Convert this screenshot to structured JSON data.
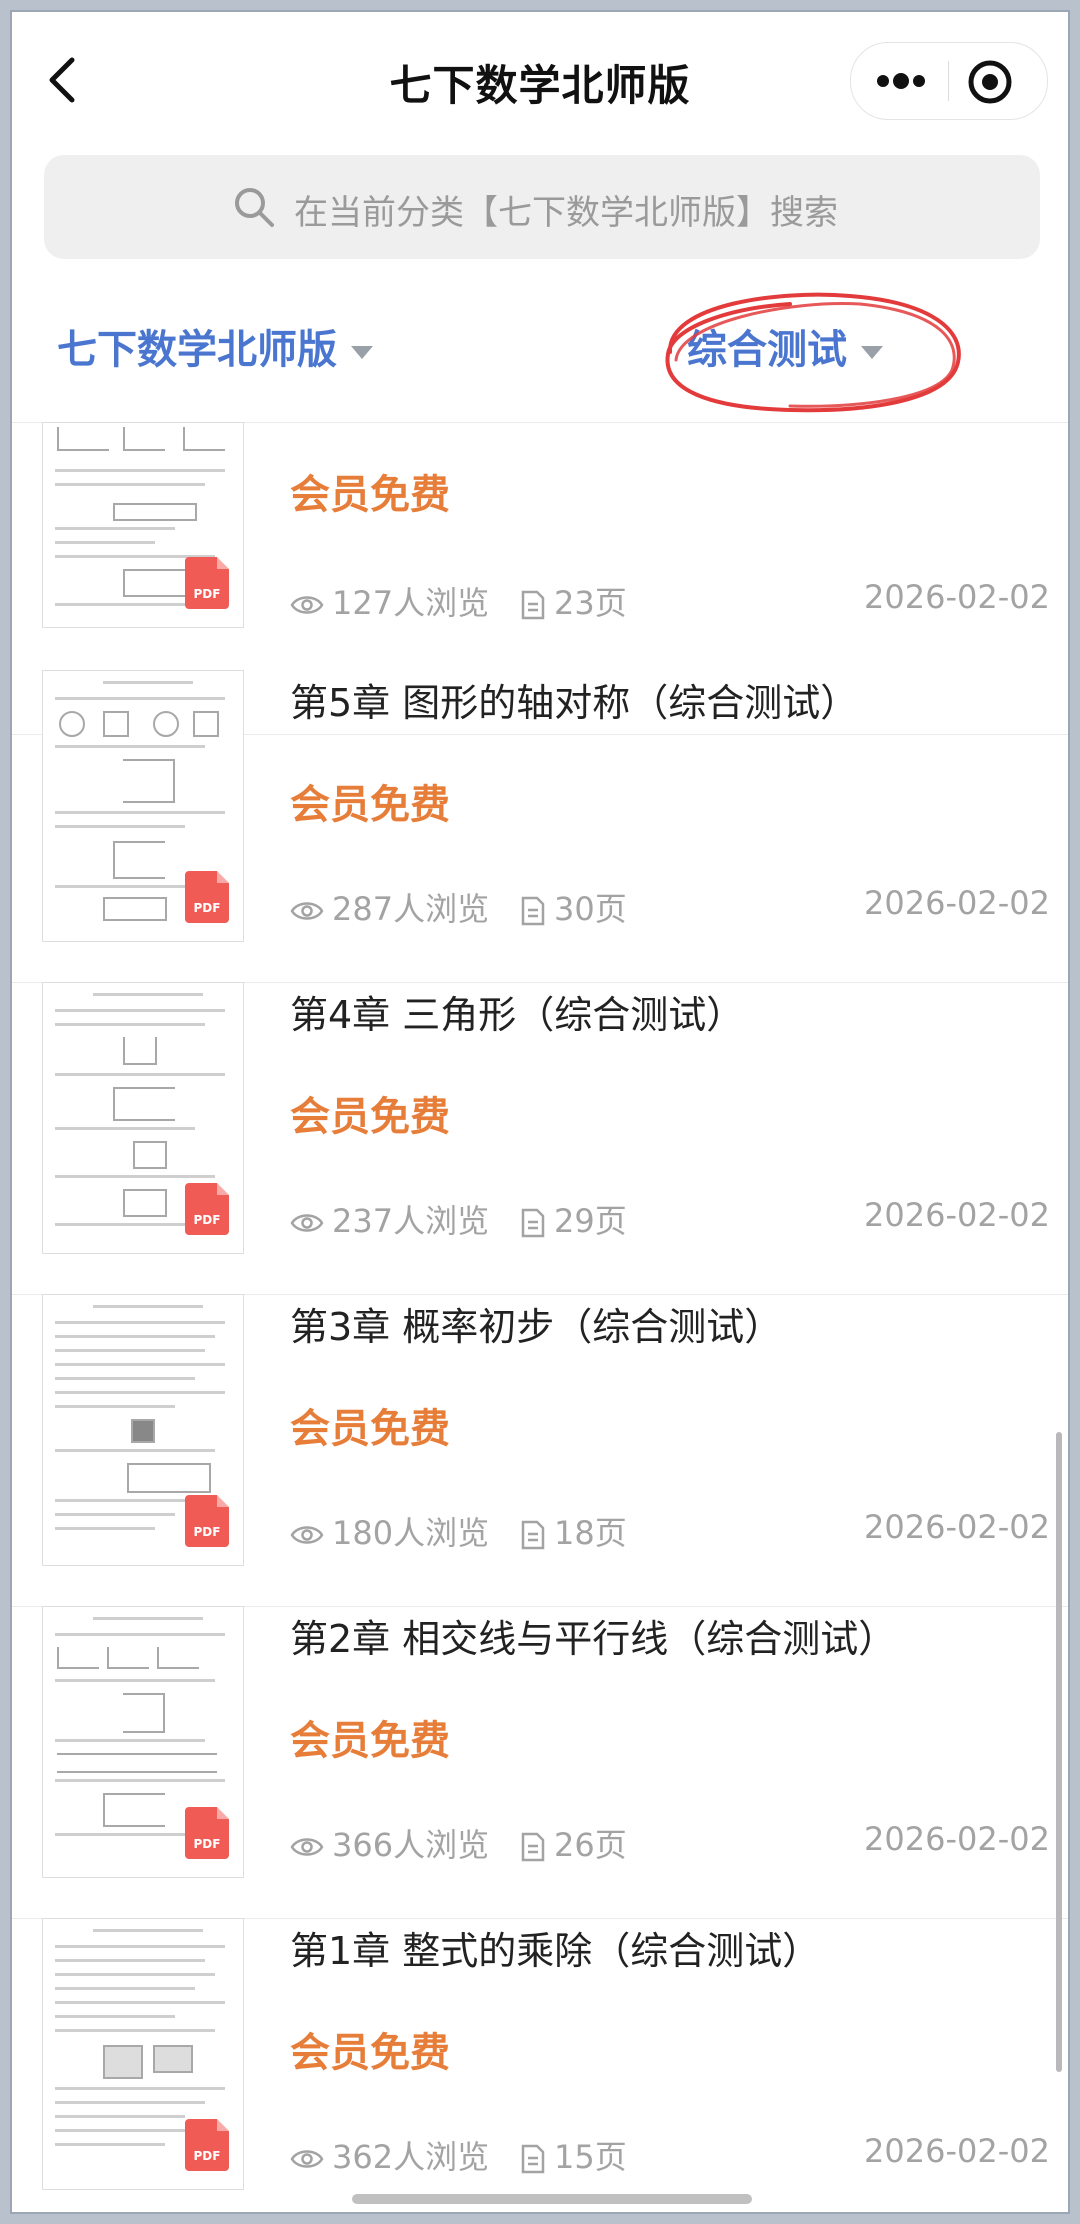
{
  "header": {
    "title": "七下数学北师版"
  },
  "search": {
    "placeholder": "在当前分类【七下数学北师版】搜索"
  },
  "filters": {
    "category": "七下数学北师版",
    "type": "综合测试"
  },
  "colors": {
    "accent_blue": "#4a76d0",
    "member_orange": "#e67e3a",
    "pdf_red": "#f15b55",
    "annotation_red": "#e33b3b"
  },
  "items": [
    {
      "title": "",
      "tag": "会员免费",
      "views": "127人浏览",
      "pages": "23页",
      "date": "2026-02-02",
      "badge": "PDF"
    },
    {
      "title": "第5章 图形的轴对称（综合测试）",
      "tag": "会员免费",
      "views": "287人浏览",
      "pages": "30页",
      "date": "2026-02-02",
      "badge": "PDF"
    },
    {
      "title": "第4章 三角形（综合测试）",
      "tag": "会员免费",
      "views": "237人浏览",
      "pages": "29页",
      "date": "2026-02-02",
      "badge": "PDF"
    },
    {
      "title": "第3章 概率初步（综合测试）",
      "tag": "会员免费",
      "views": "180人浏览",
      "pages": "18页",
      "date": "2026-02-02",
      "badge": "PDF"
    },
    {
      "title": "第2章 相交线与平行线（综合测试）",
      "tag": "会员免费",
      "views": "366人浏览",
      "pages": "26页",
      "date": "2026-02-02",
      "badge": "PDF"
    },
    {
      "title": "第1章 整式的乘除（综合测试）",
      "tag": "会员免费",
      "views": "362人浏览",
      "pages": "15页",
      "date": "2026-02-02",
      "badge": "PDF"
    }
  ],
  "icons": {
    "back": "chevron-left-icon",
    "more": "more-dots-icon",
    "close": "target-close-icon",
    "search": "search-icon",
    "views": "eye-icon",
    "pages": "document-icon"
  }
}
